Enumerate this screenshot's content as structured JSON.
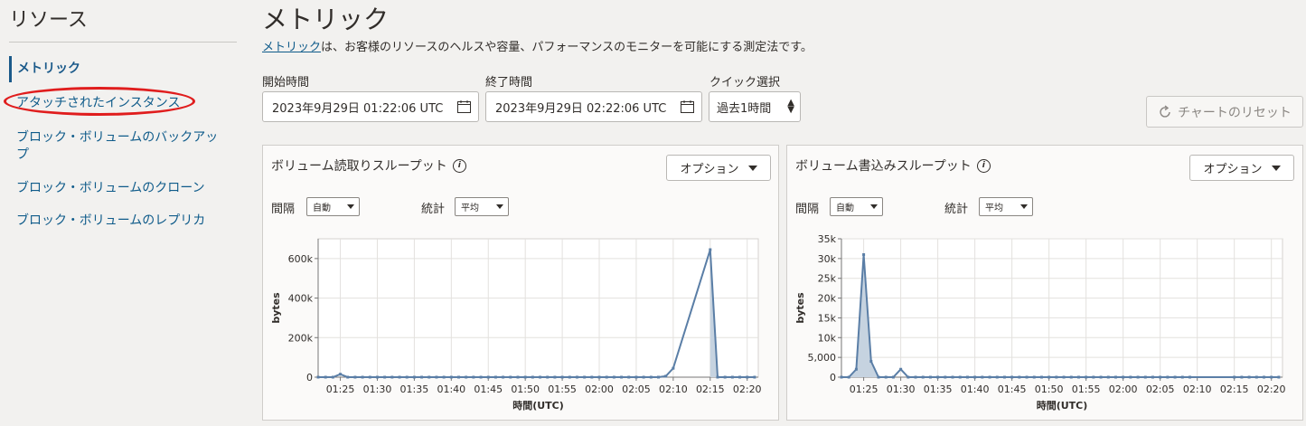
{
  "sidebar": {
    "title": "リソース",
    "items": [
      {
        "label": "メトリック",
        "active": true
      },
      {
        "label": "アタッチされたインスタンス",
        "active": false
      },
      {
        "label": "ブロック・ボリュームのバックアップ",
        "active": false
      },
      {
        "label": "ブロック・ボリュームのクローン",
        "active": false
      },
      {
        "label": "ブロック・ボリュームのレプリカ",
        "active": false
      }
    ],
    "highlight_color": "#e01d1d"
  },
  "page": {
    "title": "メトリック",
    "desc_link": "メトリック",
    "desc_rest": "は、お客様のリソースのヘルスや容量、パフォーマンスのモニターを可能にする測定法です。"
  },
  "filters": {
    "start_label": "開始時間",
    "start_value": "2023年9月29日 01:22:06 UTC",
    "end_label": "終了時間",
    "end_value": "2023年9月29日 02:22:06 UTC",
    "quick_label": "クイック選択",
    "quick_value": "過去1時間",
    "reset_label": "チャートのリセット"
  },
  "icons": {
    "calendar": "calendar-icon",
    "stepper": "up-down-stepper-icon",
    "reset": "refresh-icon",
    "info": "info-icon",
    "caret": "caret-down-icon"
  },
  "colors": {
    "link": "#0f5b8a",
    "series": "#5a7ea6",
    "fill": "#c6d3e0"
  },
  "panels": [
    {
      "title": "ボリューム読取りスループット",
      "options_label": "オプション",
      "interval_label": "間隔",
      "interval_value": "自動",
      "stat_label": "統計",
      "stat_value": "平均"
    },
    {
      "title": "ボリューム書込みスループット",
      "options_label": "オプション",
      "interval_label": "間隔",
      "interval_value": "自動",
      "stat_label": "統計",
      "stat_value": "平均"
    }
  ],
  "chart_data": [
    {
      "type": "area",
      "title": "ボリューム読取りスループット",
      "xlabel": "時間(UTC)",
      "ylabel": "bytes",
      "ylim": [
        0,
        700000
      ],
      "yticks": [
        0,
        200000,
        400000,
        600000
      ],
      "ytick_labels": [
        "0",
        "200k",
        "400k",
        "600k"
      ],
      "xticks": [
        "01:25",
        "01:30",
        "01:35",
        "01:40",
        "01:45",
        "01:50",
        "01:55",
        "02:00",
        "02:05",
        "02:10",
        "02:15",
        "02:20"
      ],
      "xtick_minutes": [
        3,
        8,
        13,
        18,
        23,
        28,
        33,
        38,
        43,
        48,
        53,
        58
      ],
      "xlim_minutes": [
        0,
        59.5
      ],
      "grid": true,
      "x_minutes": [
        0,
        1,
        2,
        3,
        4,
        5,
        6,
        7,
        8,
        9,
        10,
        11,
        12,
        13,
        14,
        15,
        16,
        17,
        18,
        19,
        20,
        21,
        22,
        23,
        24,
        25,
        26,
        27,
        28,
        29,
        30,
        31,
        32,
        33,
        34,
        35,
        36,
        37,
        38,
        39,
        40,
        41,
        42,
        43,
        44,
        45,
        46,
        47,
        48,
        53,
        54,
        55,
        56,
        57,
        58,
        59
      ],
      "values": [
        0,
        0,
        0,
        15000,
        0,
        0,
        0,
        0,
        0,
        0,
        0,
        0,
        0,
        0,
        0,
        0,
        0,
        0,
        0,
        0,
        0,
        0,
        0,
        0,
        0,
        0,
        0,
        0,
        0,
        0,
        0,
        0,
        0,
        0,
        0,
        0,
        0,
        0,
        0,
        0,
        0,
        0,
        0,
        0,
        0,
        0,
        0,
        5000,
        45000,
        645000,
        0,
        0,
        0,
        0,
        0,
        0
      ],
      "fill_from_minute": 53
    },
    {
      "type": "area",
      "title": "ボリューム書込みスループット",
      "xlabel": "時間(UTC)",
      "ylabel": "bytes",
      "ylim": [
        0,
        35000
      ],
      "yticks": [
        0,
        5000,
        10000,
        15000,
        20000,
        25000,
        30000,
        35000
      ],
      "ytick_labels": [
        "0",
        "5,000",
        "10k",
        "15k",
        "20k",
        "25k",
        "30k",
        "35k"
      ],
      "xticks": [
        "01:25",
        "01:30",
        "01:35",
        "01:40",
        "01:45",
        "01:50",
        "01:55",
        "02:00",
        "02:05",
        "02:10",
        "02:15",
        "02:20"
      ],
      "xtick_minutes": [
        3,
        8,
        13,
        18,
        23,
        28,
        33,
        38,
        43,
        48,
        53,
        58
      ],
      "xlim_minutes": [
        0,
        59.5
      ],
      "grid": true,
      "x_minutes": [
        0,
        1,
        2,
        3,
        4,
        5,
        6,
        7,
        8,
        9,
        10,
        11,
        12,
        13,
        14,
        15,
        16,
        17,
        18,
        19,
        20,
        21,
        22,
        23,
        24,
        25,
        26,
        27,
        28,
        29,
        30,
        31,
        32,
        33,
        34,
        35,
        36,
        37,
        38,
        39,
        40,
        41,
        42,
        43,
        44,
        45,
        46,
        47,
        53,
        54,
        55,
        56,
        57,
        58,
        59
      ],
      "values": [
        0,
        0,
        2000,
        31000,
        4000,
        0,
        0,
        0,
        2000,
        0,
        0,
        0,
        0,
        0,
        0,
        0,
        0,
        0,
        0,
        0,
        0,
        0,
        0,
        0,
        0,
        0,
        0,
        0,
        0,
        0,
        0,
        0,
        0,
        0,
        0,
        0,
        0,
        0,
        0,
        0,
        0,
        0,
        0,
        0,
        0,
        0,
        0,
        0,
        0,
        0,
        0,
        0,
        0,
        0,
        0
      ],
      "fill_until_minute": 5
    }
  ]
}
